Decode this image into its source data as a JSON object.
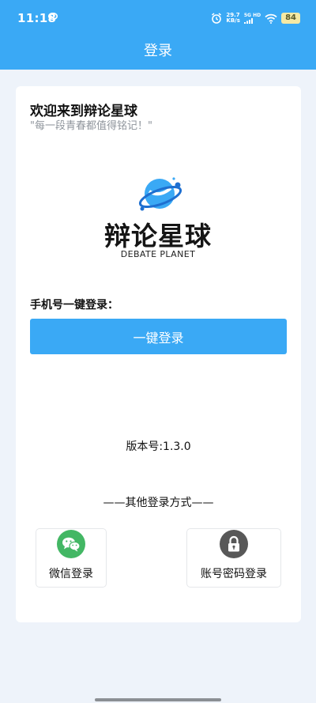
{
  "status_bar": {
    "time": "11:18",
    "speed_value": "29.7",
    "speed_unit": "KB/s",
    "net_type_top": "5G HD",
    "battery": "84"
  },
  "header": {
    "title": "登录"
  },
  "card": {
    "welcome": "欢迎来到辩论星球",
    "slogan": "\"每一段青春都值得铭记！\""
  },
  "logo": {
    "name": "辩论星球",
    "subtitle": "DEBATE PLANET"
  },
  "quick_login": {
    "label": "手机号一键登录：",
    "button_label": "一键登录"
  },
  "version": "版本号:1.3.0",
  "other_login": {
    "title": "——其他登录方式——",
    "options": [
      {
        "label": "微信登录",
        "icon": "wechat-icon"
      },
      {
        "label": "账号密码登录",
        "icon": "lock-icon"
      }
    ]
  },
  "colors": {
    "primary": "#3aa9f5",
    "background": "#eef3fa",
    "wechat_green": "#43b764",
    "lock_gray": "#585858"
  }
}
